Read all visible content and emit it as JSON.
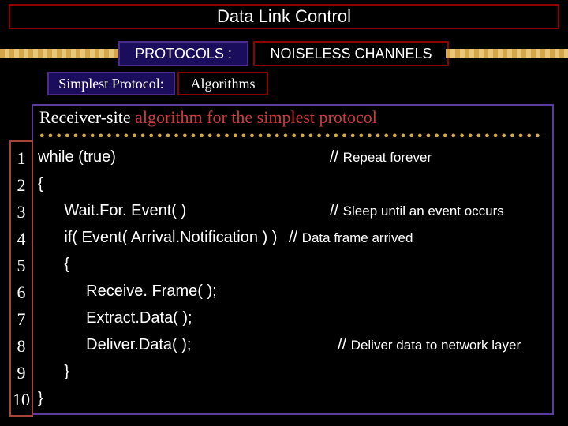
{
  "title": "Data Link Control",
  "protocols_label": "PROTOCOLS :",
  "noiseless_label": "NOISELESS CHANNELS",
  "simplest_label": "Simplest Protocol:",
  "algorithms_label": "Algorithms",
  "heading_black": "Receiver-site ",
  "heading_red": "algorithm for the simplest protocol",
  "lines": {
    "n1": "1",
    "n2": "2",
    "n3": "3",
    "n4": "4",
    "n5": "5",
    "n6": "6",
    "n7": "7",
    "n8": "8",
    "n9": "9",
    "n10": "10"
  },
  "code": {
    "l1": "while (true)",
    "l2": "{",
    "l3": "      Wait.For. Event( )",
    "l4": "      if( Event( Arrival.Notification ) )",
    "l5": "      {",
    "l6": "           Receive. Frame( );",
    "l7": "           Extract.Data( );",
    "l8": "           Deliver.Data( );",
    "l9": "      }",
    "l10": "}"
  },
  "comments": {
    "c1_slash": "// ",
    "c1": "Repeat forever",
    "c3_slash": "// ",
    "c3": "Sleep until an event occurs",
    "c4_slash": "// ",
    "c4": "Data frame arrived",
    "c8_slash": "// ",
    "c8": "Deliver data to network layer"
  },
  "dots": "●●●●●●●●●●●●●●●●●●●●●●●●●●●●●●●●●●●●●●●●●●●●●●●●●●●●●●●●●●●●●●●●●●●●●●●●●●●●●●●●●●●●●●●●●●●●●●●●●●●●●●●●●●●●●●"
}
